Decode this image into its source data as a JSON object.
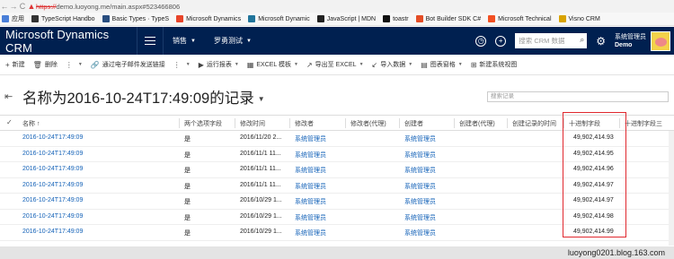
{
  "browser": {
    "url_proto": "https://",
    "url_rest": "demo.luoyong.me/main.aspx#523466806",
    "bookmarks": [
      {
        "label": "应用",
        "color": "#4a7fd8"
      },
      {
        "label": "TypeScript Handbo",
        "color": "#333333"
      },
      {
        "label": "Basic Types · TypeS",
        "color": "#294e80"
      },
      {
        "label": "Microsoft Dynamics",
        "color": "#e8442a"
      },
      {
        "label": "Microsoft Dynamic",
        "color": "#21759b"
      },
      {
        "label": "JavaScript | MDN",
        "color": "#222222"
      },
      {
        "label": "toastr",
        "color": "#111111"
      },
      {
        "label": "Bot Builder SDK C#",
        "color": "#e44d26"
      },
      {
        "label": "Microsoft Technical",
        "color": "#f25022"
      },
      {
        "label": "Visno CRM",
        "color": "#d9a300"
      }
    ]
  },
  "crm": {
    "app_title": "Microsoft Dynamics CRM",
    "area": "销售",
    "entity": "罗勇测试",
    "search_placeholder": "搜索 CRM 数据",
    "user_name": "系统管理员",
    "user_org": "Demo"
  },
  "commands": [
    {
      "icon": "+",
      "label": "新建",
      "dropdown": false
    },
    {
      "icon": "🗑",
      "label": "删除",
      "dropdown": false
    },
    {
      "icon": "⋮",
      "label": "",
      "dropdown": true
    },
    {
      "icon": "🔗",
      "label": "通过电子邮件发送链接",
      "dropdown": false
    },
    {
      "icon": "⋮",
      "label": "",
      "dropdown": true
    },
    {
      "icon": "▶",
      "label": "运行报表",
      "dropdown": true
    },
    {
      "icon": "▦",
      "label": "EXCEL 模板",
      "dropdown": true
    },
    {
      "icon": "↗",
      "label": "导出至 EXCEL",
      "dropdown": true
    },
    {
      "icon": "↙",
      "label": "导入数据",
      "dropdown": true
    },
    {
      "icon": "▤",
      "label": "图表窗格",
      "dropdown": true
    },
    {
      "icon": "⊞",
      "label": "新建系统视图",
      "dropdown": false
    }
  ],
  "view": {
    "title": "名称为2016-10-24T17:49:09的记录",
    "search_placeholder": "搜索记录"
  },
  "grid": {
    "columns": [
      "名称 ↑",
      "两个选项字段",
      "修改时间",
      "修改者",
      "修改者(代理)",
      "创建者",
      "创建者(代理)",
      "创建记录的时间",
      "十进制字段",
      "十进制字段三"
    ],
    "rows": [
      {
        "name": "2016-10-24T17:49:09",
        "opt": "是",
        "mod_time": "2016/11/20 2...",
        "mod_by": "系统管理员",
        "created_by": "系统管理员",
        "decimal": "49,902,414.93"
      },
      {
        "name": "2016-10-24T17:49:09",
        "opt": "是",
        "mod_time": "2016/11/1 11...",
        "mod_by": "系统管理员",
        "created_by": "系统管理员",
        "decimal": "49,902,414.95"
      },
      {
        "name": "2016-10-24T17:49:09",
        "opt": "是",
        "mod_time": "2016/11/1 11...",
        "mod_by": "系统管理员",
        "created_by": "系统管理员",
        "decimal": "49,902,414.96"
      },
      {
        "name": "2016-10-24T17:49:09",
        "opt": "是",
        "mod_time": "2016/11/1 11...",
        "mod_by": "系统管理员",
        "created_by": "系统管理员",
        "decimal": "49,902,414.97"
      },
      {
        "name": "2016-10-24T17:49:09",
        "opt": "是",
        "mod_time": "2016/10/29 1...",
        "mod_by": "系统管理员",
        "created_by": "系统管理员",
        "decimal": "49,902,414.97"
      },
      {
        "name": "2016-10-24T17:49:09",
        "opt": "是",
        "mod_time": "2016/10/29 1...",
        "mod_by": "系统管理员",
        "created_by": "系统管理员",
        "decimal": "49,902,414.98"
      },
      {
        "name": "2016-10-24T17:49:09",
        "opt": "是",
        "mod_time": "2016/10/29 1...",
        "mod_by": "系统管理员",
        "created_by": "系统管理员",
        "decimal": "49,902,414.99"
      }
    ]
  },
  "watermark": "luoyong0201.blog.163.com",
  "colors": {
    "nav_bg": "#002050",
    "link": "#1160b7",
    "highlight": "#e0282e"
  }
}
